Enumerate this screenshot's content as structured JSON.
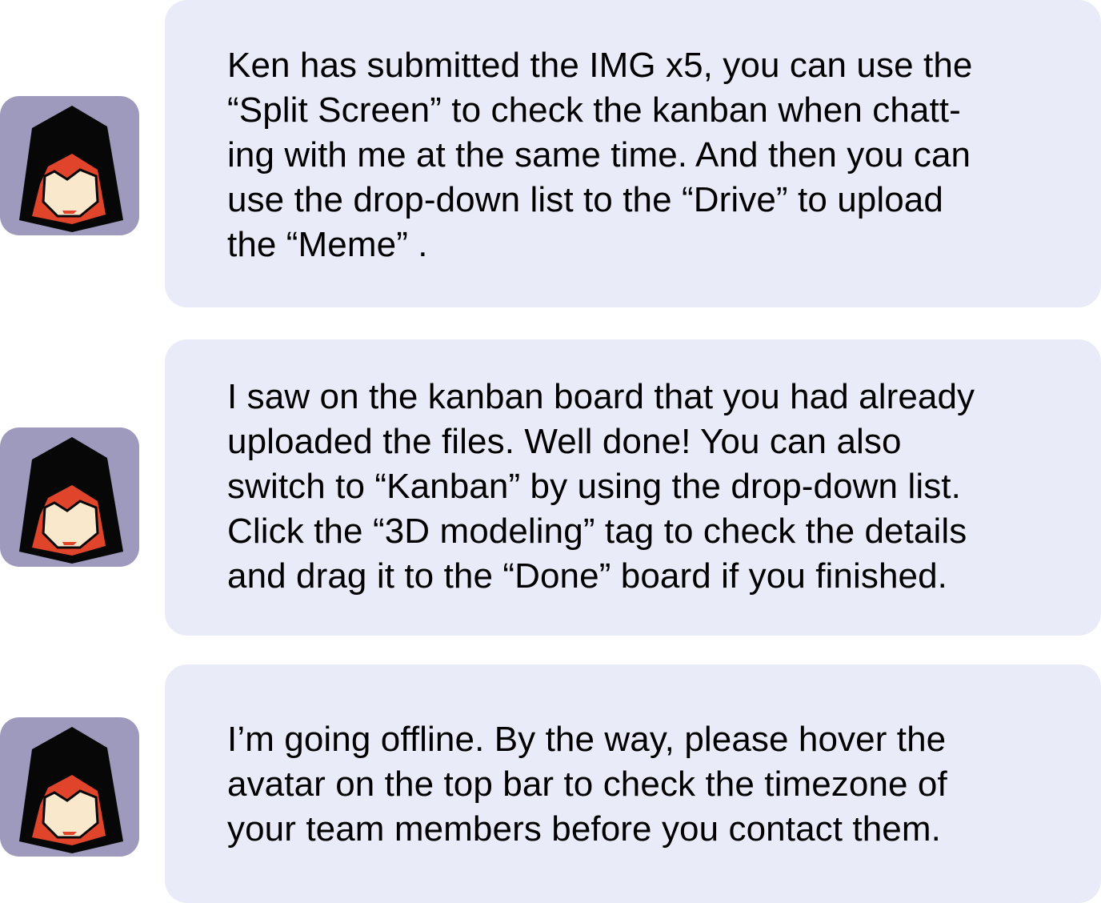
{
  "colors": {
    "bubble_bg": "#e9ecf8",
    "avatar_bg": "#9d9abd",
    "hood": "#070707",
    "hood_lining": "#e0452c",
    "face": "#f9e8cc",
    "mouth": "#e0452c"
  },
  "messages": [
    {
      "avatar_icon": "hooded-assassin-avatar-icon",
      "lines": [
        "Ken has submitted the IMG x5, you can use the",
        "“Split Screen”  to check the kanban when chatt-",
        "ing with me at the same time. And then you can",
        "use the drop-down list to the “Drive” to  upload",
        "the “Meme” ."
      ]
    },
    {
      "avatar_icon": "hooded-assassin-avatar-icon",
      "lines": [
        "I saw on the kanban board that you had already",
        "uploaded the files. Well done! You can also",
        "switch to “Kanban” by using the drop-down list.",
        "Click the “3D modeling” tag to check the details",
        "and drag it to the “Done” board if you finished."
      ]
    },
    {
      "avatar_icon": "hooded-assassin-avatar-icon",
      "lines": [
        "I’m going offline. By the way, please hover the",
        "avatar on the top bar to check the timezone of",
        "your team members before you contact them."
      ]
    }
  ]
}
